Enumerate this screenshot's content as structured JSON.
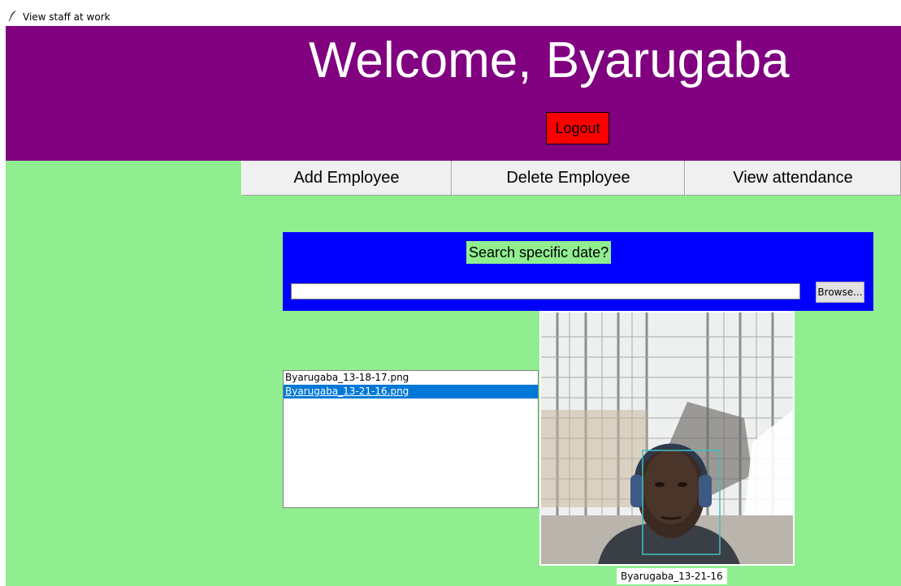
{
  "window": {
    "title": "View staff at work",
    "icon": "feather-icon"
  },
  "header": {
    "welcome_text": "Welcome, Byarugaba",
    "logout_label": "Logout",
    "bg_color": "#800080",
    "logout_color": "#ff0000"
  },
  "nav": {
    "items": [
      {
        "label": "Add Employee"
      },
      {
        "label": "Delete Employee"
      },
      {
        "label": "View attendance"
      }
    ]
  },
  "search": {
    "label": "Search specific date?",
    "input_value": "",
    "browse_label": "Browse...",
    "panel_color": "#0000ff"
  },
  "files": {
    "items": [
      {
        "name": "Byarugaba_13-18-17.png",
        "selected": false
      },
      {
        "name": "Byarugaba_13-21-16.png",
        "selected": true
      }
    ]
  },
  "photo": {
    "caption": "Byarugaba_13-21-16"
  },
  "colors": {
    "content_bg": "#90ee90",
    "selection": "#0078d7"
  }
}
